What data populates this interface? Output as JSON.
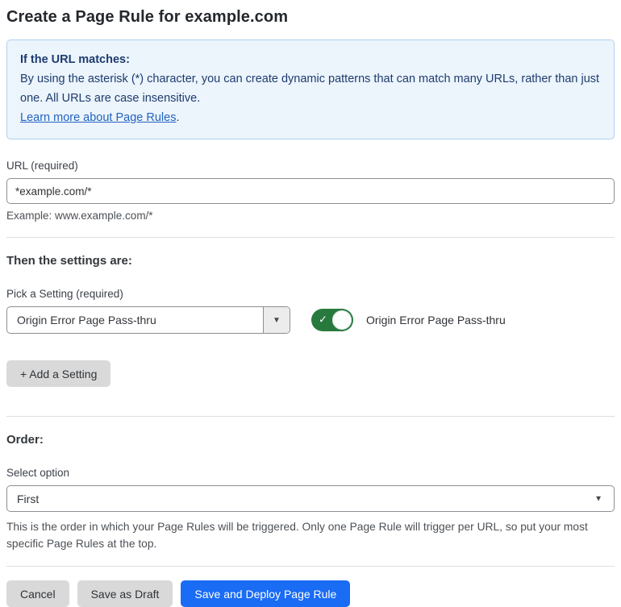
{
  "page": {
    "title": "Create a Page Rule for example.com"
  },
  "info_box": {
    "heading": "If the URL matches:",
    "body": "By using the asterisk (*) character, you can create dynamic patterns that can match many URLs, rather than just one. All URLs are case insensitive.",
    "link_label": "Learn more about Page Rules",
    "link_suffix": "."
  },
  "url_section": {
    "label": "URL (required)",
    "value": "*example.com/*",
    "hint": "Example: www.example.com/*"
  },
  "settings_section": {
    "heading": "Then the settings are:",
    "picker_label": "Pick a Setting (required)",
    "picker_value": "Origin Error Page Pass-thru",
    "picker_arrow": "▼",
    "toggle_state": "on",
    "toggle_check": "✓",
    "toggle_label": "Origin Error Page Pass-thru",
    "add_button_label": "+ Add a Setting"
  },
  "order_section": {
    "heading": "Order:",
    "select_label": "Select option",
    "select_value": "First",
    "select_arrow": "▼",
    "help_text": "This is the order in which your Page Rules will be triggered. Only one Page Rule will trigger per URL, so put your most specific Page Rules at the top."
  },
  "footer": {
    "cancel_label": "Cancel",
    "save_draft_label": "Save as Draft",
    "save_deploy_label": "Save and Deploy Page Rule"
  },
  "colors": {
    "primary_button_blue": "#1a6cf5",
    "toggle_green": "#28793e",
    "info_box_background": "#ecf4fc",
    "info_box_border": "#b0d1ef",
    "info_box_text": "#1d3c6e",
    "link_blue": "#2264c1"
  }
}
